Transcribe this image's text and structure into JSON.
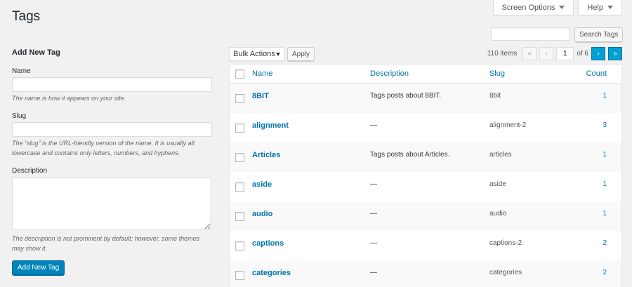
{
  "page": {
    "title": "Tags"
  },
  "screen_meta": {
    "screen_options": "Screen Options",
    "help": "Help"
  },
  "add_form": {
    "title": "Add New Tag",
    "name_label": "Name",
    "name_value": "",
    "name_help": "The name is how it appears on your site.",
    "slug_label": "Slug",
    "slug_value": "",
    "slug_help": "The “slug” is the URL-friendly version of the name. It is usually all lowercase and contains only letters, numbers, and hyphens.",
    "description_label": "Description",
    "description_value": "",
    "description_help": "The description is not prominent by default; however, some themes may show it.",
    "submit": "Add New Tag"
  },
  "search": {
    "value": "",
    "button": "Search Tags"
  },
  "bulk": {
    "selected": "Bulk Actions",
    "apply": "Apply"
  },
  "pagination": {
    "count": "110 items",
    "first": "«",
    "prev": "‹",
    "current": "1",
    "of": "of 6",
    "next": "›",
    "last": "»"
  },
  "table": {
    "headers": {
      "name": "Name",
      "description": "Description",
      "slug": "Slug",
      "count": "Count"
    },
    "rows": [
      {
        "name": "8BIT",
        "description": "Tags posts about 8BIT.",
        "slug": "8bit",
        "count": "1"
      },
      {
        "name": "alignment",
        "description": "—",
        "slug": "alignment-2",
        "count": "3"
      },
      {
        "name": "Articles",
        "description": "Tags posts about Articles.",
        "slug": "articles",
        "count": "1"
      },
      {
        "name": "aside",
        "description": "—",
        "slug": "aside",
        "count": "1"
      },
      {
        "name": "audio",
        "description": "—",
        "slug": "audio",
        "count": "1"
      },
      {
        "name": "captions",
        "description": "—",
        "slug": "captions-2",
        "count": "2"
      },
      {
        "name": "categories",
        "description": "—",
        "slug": "categories",
        "count": "2"
      }
    ]
  },
  "colors": {
    "primary": "#0085ba",
    "link": "#0073aa",
    "background": "#f1f1f1"
  }
}
